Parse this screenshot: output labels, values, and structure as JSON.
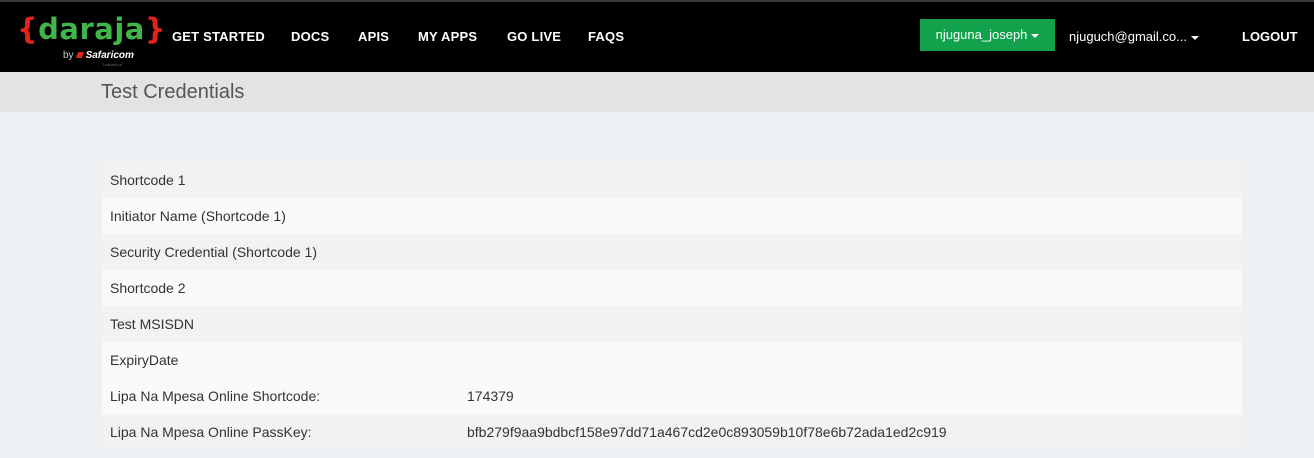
{
  "logo": {
    "brace_open": "{",
    "word": "daraja",
    "brace_close": "}",
    "by": "by",
    "company": "Safaricom",
    "tagline": "Twaweza"
  },
  "nav": {
    "items": [
      {
        "label": "GET STARTED"
      },
      {
        "label": "DOCS"
      },
      {
        "label": "APIS"
      },
      {
        "label": "MY APPS"
      },
      {
        "label": "GO LIVE"
      },
      {
        "label": "FAQS"
      }
    ]
  },
  "user": {
    "username": "njuguna_joseph",
    "email": "njuguch@gmail.co...",
    "logout_label": "LOGOUT"
  },
  "page": {
    "title": "Test Credentials"
  },
  "credentials": {
    "rows": [
      {
        "label": "Shortcode 1",
        "value": ""
      },
      {
        "label": "Initiator Name (Shortcode 1)",
        "value": ""
      },
      {
        "label": "Security Credential (Shortcode 1)",
        "value": ""
      },
      {
        "label": "Shortcode 2",
        "value": ""
      },
      {
        "label": "Test MSISDN",
        "value": ""
      },
      {
        "label": "ExpiryDate",
        "value": ""
      },
      {
        "label": "Lipa Na Mpesa Online Shortcode:",
        "value": "174379"
      },
      {
        "label": "Lipa Na Mpesa Online PassKey:",
        "value": "bfb279f9aa9bdbcf158e97dd71a467cd2e0c893059b10f78e6b72ada1ed2c919"
      }
    ]
  },
  "colors": {
    "topbar": "#000000",
    "brand_green": "#3fb54a",
    "brand_red": "#e2231a",
    "user_button": "#11a24b",
    "title_bar": "#e3e3e3",
    "page_bg": "#eef1f4"
  }
}
